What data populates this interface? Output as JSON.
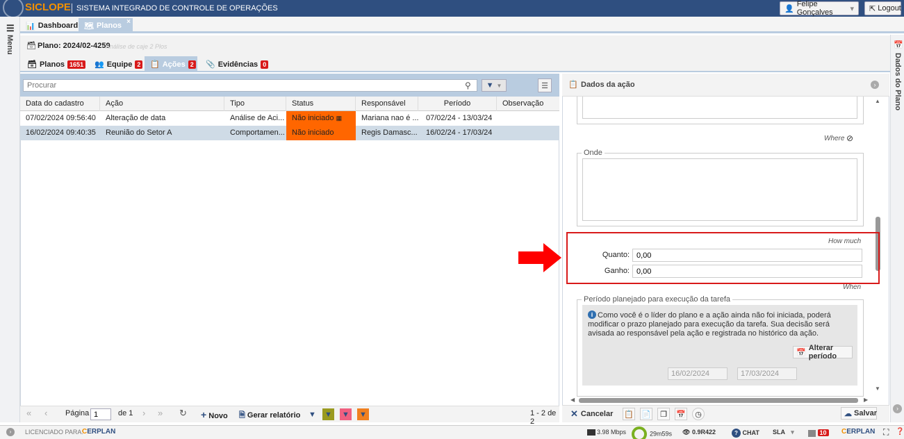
{
  "app": {
    "logo": "SICLOPE",
    "title": "SISTEMA INTEGRADO DE CONTROLE DE OPERAÇÕES",
    "user": "Felipe Gonçalves",
    "logout": "Logout",
    "menu_label": "Menu",
    "right_rail_label": "Dados do Plano"
  },
  "tabs": [
    {
      "label": "Dashboard"
    },
    {
      "label": "Planos",
      "close": "×"
    }
  ],
  "plan": {
    "label": "Plano: 2024/02-4259",
    "subtitle": "Análise de caje 2 Plos"
  },
  "subtabs": [
    {
      "label": "Planos",
      "count": "1651"
    },
    {
      "label": "Equipe",
      "count": "2"
    },
    {
      "label": "Ações",
      "count": "2"
    },
    {
      "label": "Evidências",
      "count": "0"
    }
  ],
  "search": {
    "placeholder": "Procurar"
  },
  "grid": {
    "columns": [
      "Data do cadastro",
      "Ação",
      "Tipo",
      "Status",
      "Responsável",
      "Período",
      "Observação"
    ],
    "rows": [
      {
        "data": "07/02/2024 09:56:40",
        "acao": "Alteração de data",
        "tipo": "Análise de Aci...",
        "status": "Não iniciado",
        "responsavel": "Mariana nao é ...",
        "periodo": "07/02/24 - 13/03/24",
        "obs": ""
      },
      {
        "data": "16/02/2024 09:40:35",
        "acao": "Reunião do Setor A",
        "tipo": "Comportamen...",
        "status": "Não iniciado",
        "responsavel": "Regis Damasc...",
        "periodo": "16/02/24 - 17/03/24",
        "obs": ""
      }
    ],
    "status_color": "#ff6600"
  },
  "pager": {
    "page_label": "Página",
    "page": "1",
    "of": "de 1",
    "novo": "Novo",
    "relatorio": "Gerar relatório",
    "range": "1 - 2 de 2"
  },
  "details": {
    "title": "Dados da ação",
    "where_hint": "Where",
    "onde_legend": "Onde",
    "howmuch_hint": "How much",
    "quanto_label": "Quanto:",
    "quanto_value": "0,00",
    "ganho_label": "Ganho:",
    "ganho_value": "0,00",
    "when_hint": "When",
    "periodo_legend": "Período planejado para execução da tarefa",
    "info": "Como você é o líder do plano e a ação ainda não foi iniciada, poderá modificar o prazo planejado para execução da tarefa. Sua decisão será avisada ao responsável pela ação e registrada no histórico da ação.",
    "alterar": "Alterar período",
    "start": "16/02/2024",
    "end": "17/03/2024",
    "cancelar": "Cancelar",
    "salvar": "Salvar"
  },
  "statusbar": {
    "licensed": "LICENCIADO PARA:",
    "brand": "ERPLAN",
    "speed": "3.98 Mbps",
    "time": "29m59s",
    "version": "0.9R422",
    "chat": "CHAT",
    "sla": "SLA",
    "alerts": "10",
    "brand2": "ERPLAN"
  },
  "colors": {
    "accent": "#2f4f80",
    "tab_active": "#b9cce0",
    "badge": "#d81a1a",
    "highlight": "#d81a1a"
  }
}
